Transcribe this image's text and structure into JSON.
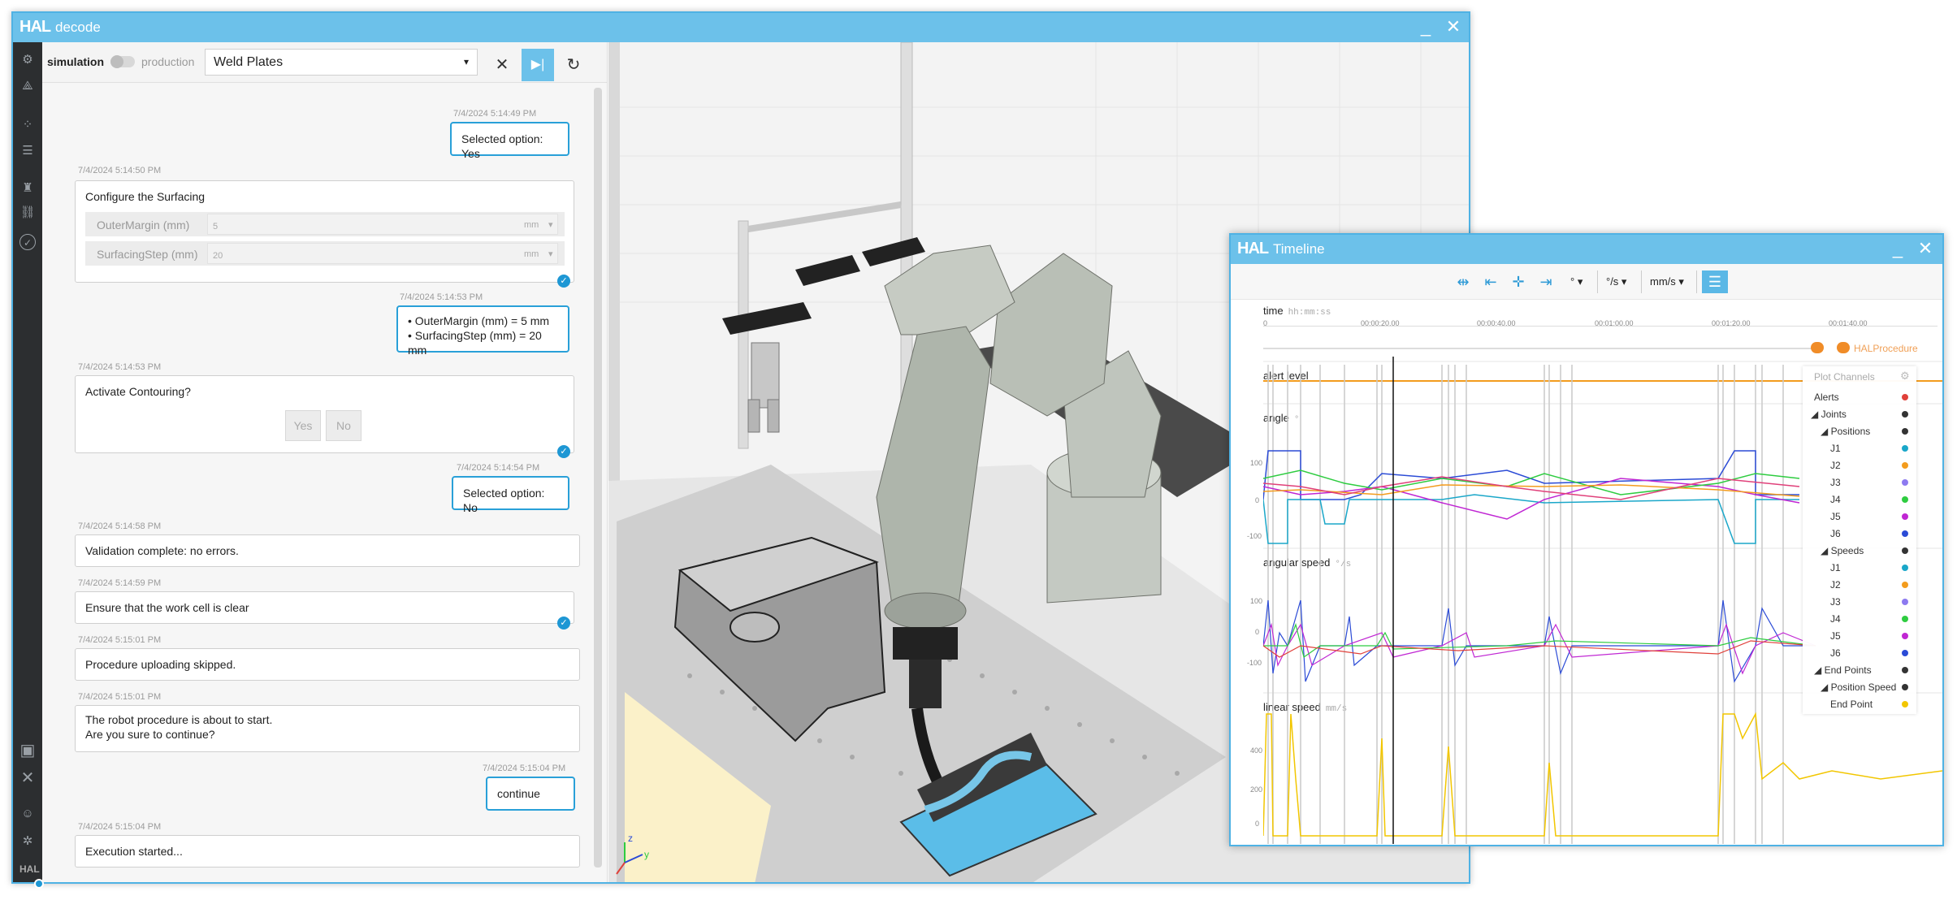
{
  "main_window": {
    "logo": "HAL",
    "title": "decode",
    "minimize": "_",
    "close": "✕"
  },
  "toolbar": {
    "mode_left": "simulation",
    "mode_right": "production",
    "procedure": "Weld Plates",
    "caret": "▾"
  },
  "messages": [
    {
      "ts": "7/4/2024 5:14:49 PM",
      "text": "Selected option: Yes"
    },
    {
      "ts": "7/4/2024 5:14:50 PM",
      "text": "Configure the Surfacing"
    },
    {
      "ts": "7/4/2024 5:14:53 PM",
      "line1": "• OuterMargin (mm) = 5 mm",
      "line2": "• SurfacingStep (mm) = 20 mm"
    },
    {
      "ts": "7/4/2024 5:14:53 PM",
      "text": "Activate Contouring?"
    },
    {
      "ts": "7/4/2024 5:14:54 PM",
      "text": "Selected option: No"
    },
    {
      "ts": "7/4/2024 5:14:58 PM",
      "text": "Validation complete: no errors."
    },
    {
      "ts": "7/4/2024 5:14:59 PM",
      "text": "Ensure that the work cell is clear"
    },
    {
      "ts": "7/4/2024 5:15:01 PM",
      "text": "Procedure uploading skipped."
    },
    {
      "ts": "7/4/2024 5:15:01 PM",
      "line1": "The robot procedure is about to start.",
      "line2": "Are you sure to continue?"
    },
    {
      "ts": "7/4/2024 5:15:04 PM",
      "text": "continue"
    },
    {
      "ts": "7/4/2024 5:15:04 PM",
      "text": "Execution started..."
    }
  ],
  "surfacing_form": {
    "outer_margin_label": "OuterMargin (mm)",
    "outer_margin_value": "5",
    "outer_margin_unit": "mm",
    "surfacing_step_label": "SurfacingStep (mm)",
    "surfacing_step_value": "20",
    "surfacing_step_unit": "mm"
  },
  "contour_buttons": {
    "yes": "Yes",
    "no": "No"
  },
  "viewport_axes": {
    "z": "z",
    "y": "y"
  },
  "timeline": {
    "logo": "HAL",
    "title": "Timeline",
    "minimize": "_",
    "close": "✕",
    "angle_unit_select": "°",
    "angular_speed_unit_select": "°/s",
    "linear_speed_unit_select": "mm/s",
    "time_label": "time",
    "time_format": "hh:mm:ss",
    "time_ticks": [
      "0",
      "00:00:20.00",
      "00:00:40.00",
      "00:01:00.00",
      "00:01:20.00",
      "00:01:40.00"
    ],
    "procedure_marker": "HALProcedure",
    "alert_label": "alert level",
    "angle_label": "angle",
    "angle_unit": "°",
    "angular_speed_label": "angular speed",
    "angular_speed_unit": "°/s",
    "linear_speed_label": "linear speed",
    "linear_speed_unit": "mm/s",
    "angle_ticks": [
      "100",
      "0",
      "-100"
    ],
    "angular_speed_ticks": [
      "100",
      "0",
      "-100"
    ],
    "linear_speed_ticks": [
      "400",
      "200",
      "0"
    ]
  },
  "channels": {
    "title": "Plot Channels",
    "items": [
      {
        "label": "Alerts",
        "color": "#e0403a"
      },
      {
        "label": "◢ Joints",
        "color": "#333333"
      },
      {
        "label": "◢ Positions",
        "color": "#333333"
      },
      {
        "label": "J1",
        "color": "#1aa7c9"
      },
      {
        "label": "J2",
        "color": "#f39c1e"
      },
      {
        "label": "J3",
        "color": "#8d7af0"
      },
      {
        "label": "J4",
        "color": "#2ecc40"
      },
      {
        "label": "J5",
        "color": "#c026d3"
      },
      {
        "label": "J6",
        "color": "#2b4bd6"
      },
      {
        "label": "◢ Speeds",
        "color": "#333333"
      },
      {
        "label": "J1",
        "color": "#1aa7c9"
      },
      {
        "label": "J2",
        "color": "#f39c1e"
      },
      {
        "label": "J3",
        "color": "#8d7af0"
      },
      {
        "label": "J4",
        "color": "#2ecc40"
      },
      {
        "label": "J5",
        "color": "#c026d3"
      },
      {
        "label": "J6",
        "color": "#2b4bd6"
      },
      {
        "label": "◢ End Points",
        "color": "#333333"
      },
      {
        "label": "◢ Position Speed",
        "color": "#333333"
      },
      {
        "label": "End Point",
        "color": "#f2c600"
      }
    ]
  }
}
